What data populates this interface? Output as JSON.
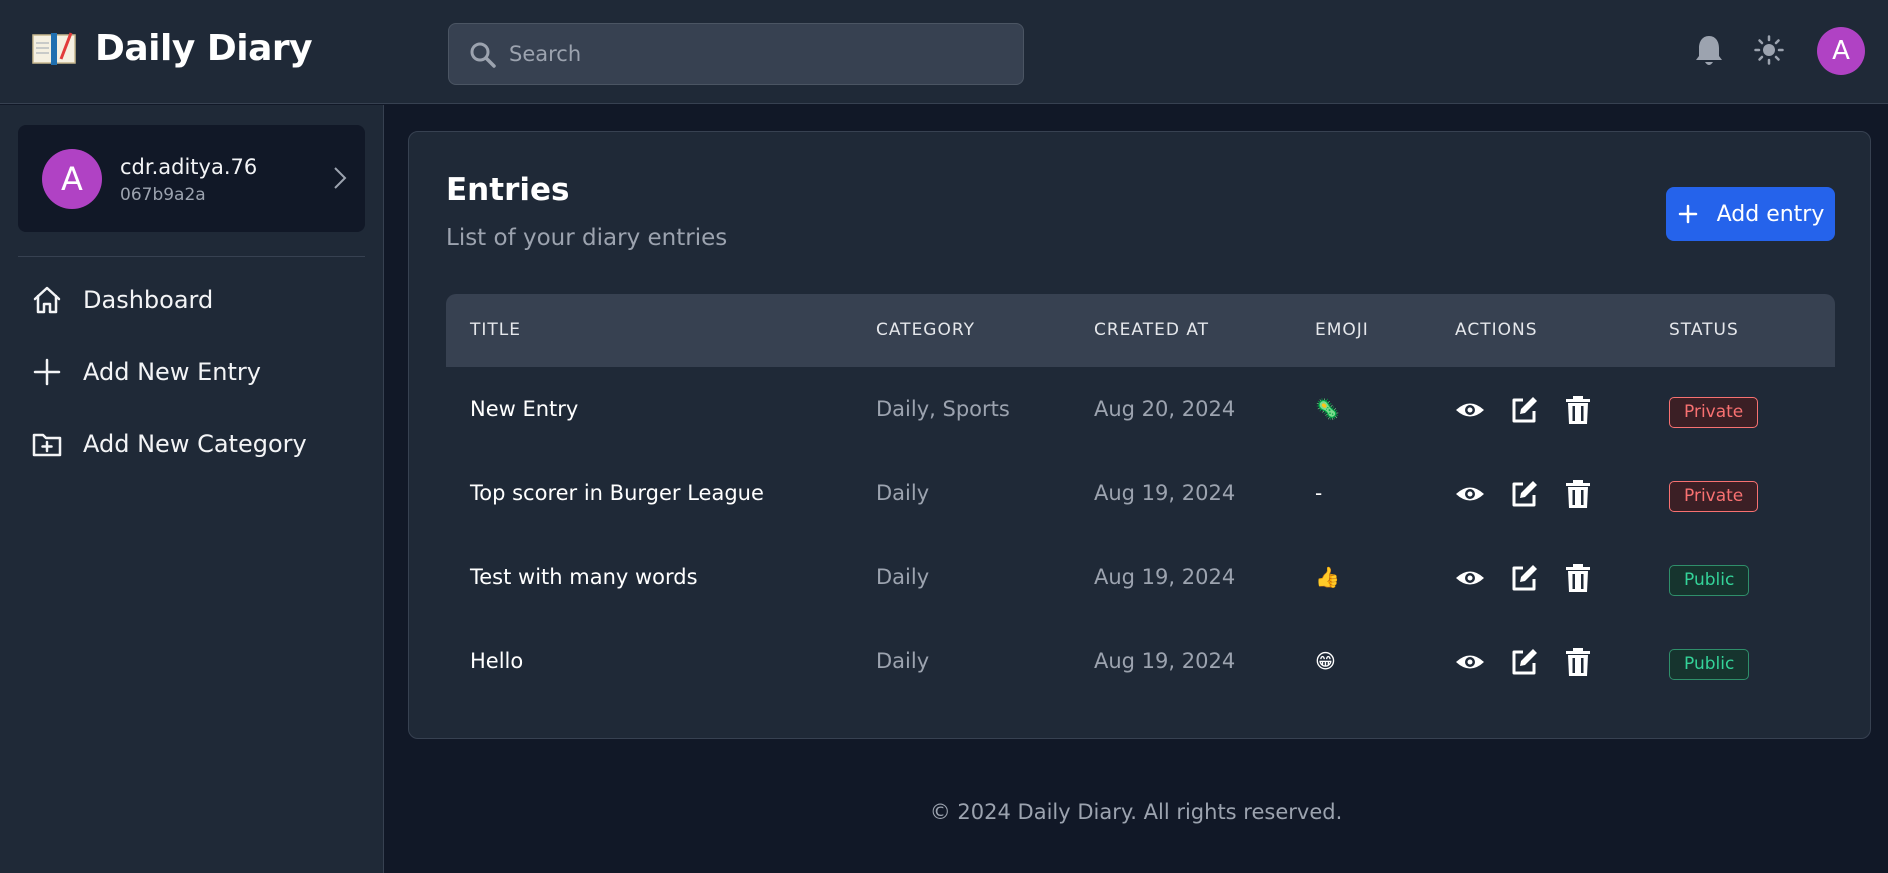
{
  "app": {
    "title": "Daily Diary"
  },
  "header": {
    "search_placeholder": "Search",
    "avatar_letter": "A",
    "icons": [
      "search-icon",
      "bell-icon",
      "sun-icon"
    ]
  },
  "sidebar": {
    "user": {
      "avatar_letter": "A",
      "name": "cdr.aditya.76",
      "id": "067b9a2a"
    },
    "items": [
      {
        "label": "Dashboard",
        "icon": "home-icon"
      },
      {
        "label": "Add New Entry",
        "icon": "plus-icon"
      },
      {
        "label": "Add New Category",
        "icon": "folder-plus-icon"
      }
    ]
  },
  "main": {
    "title": "Entries",
    "subtitle": "List of your diary entries",
    "add_button": "Add entry",
    "columns": [
      "TITLE",
      "CATEGORY",
      "CREATED AT",
      "EMOJI",
      "ACTIONS",
      "STATUS"
    ],
    "rows": [
      {
        "title": "New Entry",
        "category": "Daily, Sports",
        "created_at": "Aug 20, 2024",
        "emoji": "🦠",
        "status": "Private"
      },
      {
        "title": "Top scorer in Burger League",
        "category": "Daily",
        "created_at": "Aug 19, 2024",
        "emoji": "-",
        "status": "Private"
      },
      {
        "title": "Test with many words",
        "category": "Daily",
        "created_at": "Aug 19, 2024",
        "emoji": "👍",
        "status": "Public"
      },
      {
        "title": "Hello",
        "category": "Daily",
        "created_at": "Aug 19, 2024",
        "emoji": "😁",
        "status": "Public"
      }
    ]
  },
  "footer": {
    "text": "© 2024 Daily Diary. All rights reserved."
  },
  "colors": {
    "background": "#111827",
    "surface": "#1f2937",
    "accent": "#2563eb",
    "avatar": "#b042c4",
    "private": "#f87171",
    "public": "#34d399"
  }
}
